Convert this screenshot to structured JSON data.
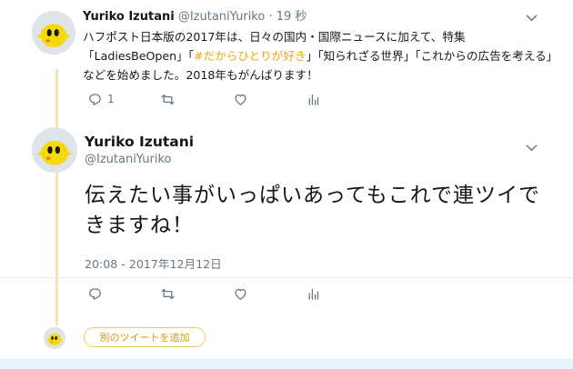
{
  "colors": {
    "accent": "#f2a70a",
    "thread_line": "#f6e3b4",
    "muted": "#657786"
  },
  "tweet1": {
    "name": "Yuriko Izutani",
    "handle": "@IzutaniYuriko",
    "separator": "·",
    "time": "19 秒",
    "text_a": "ハフポスト日本版の2017年は、日々の国内・国際ニュースに加えて、特集「LadiesBeOpen」「",
    "hashtag": "#だからひとりが好き",
    "text_b": "」「知られざる世界」「これからの広告を考える」などを始めました。2018年もがんばります！",
    "reply_count": "1",
    "icons": [
      "reply-icon",
      "retweet-icon",
      "like-icon",
      "analytics-icon"
    ]
  },
  "tweet2": {
    "name": "Yuriko Izutani",
    "handle": "@IzutaniYuriko",
    "text": "伝えたい事がいっぱいあってもこれで連ツイできますね！",
    "timestamp": "20:08 - 2017年12月12日",
    "icons": [
      "reply-icon",
      "retweet-icon",
      "like-icon",
      "analytics-icon"
    ]
  },
  "composer": {
    "add_label": "別のツイートを追加"
  }
}
